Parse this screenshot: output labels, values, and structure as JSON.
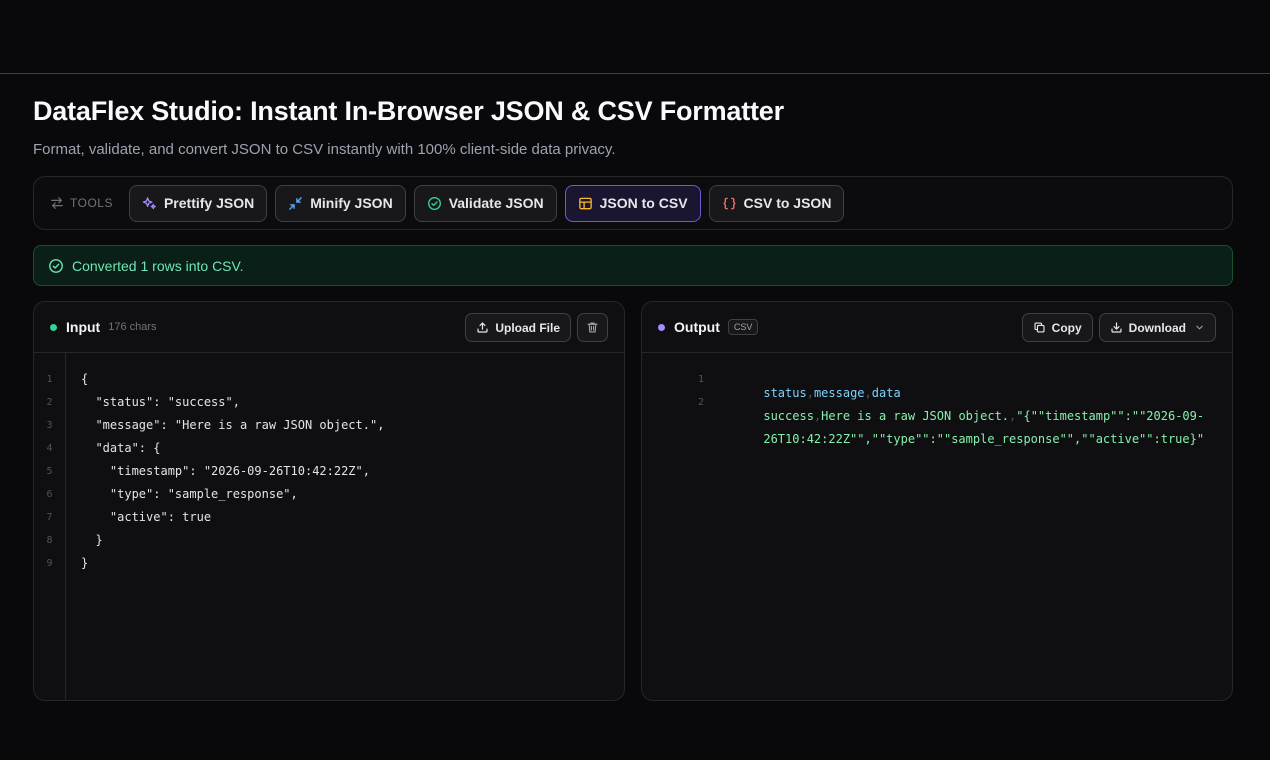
{
  "header": {
    "title": "DataFlex Studio: Instant In-Browser JSON & CSV Formatter",
    "subtitle": "Format, validate, and convert JSON to CSV instantly with 100% client-side data privacy."
  },
  "toolbar": {
    "label": "TOOLS",
    "buttons": [
      {
        "label": "Prettify JSON",
        "icon": "sparkles-icon",
        "icon_color": "#a78bfa"
      },
      {
        "label": "Minify JSON",
        "icon": "minimize-icon",
        "icon_color": "#60a5fa"
      },
      {
        "label": "Validate JSON",
        "icon": "check-circle-icon",
        "icon_color": "#34d399"
      },
      {
        "label": "JSON to CSV",
        "icon": "table-icon",
        "icon_color": "#fbbf24",
        "active": true
      },
      {
        "label": "CSV to JSON",
        "icon": "braces-icon",
        "icon_color": "#f87171"
      }
    ]
  },
  "status": {
    "message": "Converted 1 rows into CSV.",
    "color": "#6ee7b7"
  },
  "input_panel": {
    "title": "Input",
    "char_count": "176 chars",
    "dot_color": "#34d399",
    "upload_label": "Upload File",
    "line_numbers": [
      "1",
      "2",
      "3",
      "4",
      "5",
      "6",
      "7",
      "8",
      "9"
    ],
    "lines": [
      "{",
      "  \"status\": \"success\",",
      "  \"message\": \"Here is a raw JSON object.\",",
      "  \"data\": {",
      "    \"timestamp\": \"2026-09-26T10:42:22Z\",",
      "    \"type\": \"sample_response\",",
      "    \"active\": true",
      "  }",
      "}"
    ]
  },
  "output_panel": {
    "title": "Output",
    "badge": "CSV",
    "dot_color": "#a78bfa",
    "copy_label": "Copy",
    "download_label": "Download",
    "line_numbers": [
      "1",
      "2"
    ],
    "header_fields": [
      "status",
      "message",
      "data"
    ],
    "row_fields": [
      "success",
      "Here is a raw JSON object.",
      "\"{\"\"timestamp\"\":\"\"2026-09-"
    ],
    "row_continuation": "26T10:42:22Z\"\",\"\"type\"\":\"\"sample_response\"\",\"\"active\"\":true}\""
  }
}
